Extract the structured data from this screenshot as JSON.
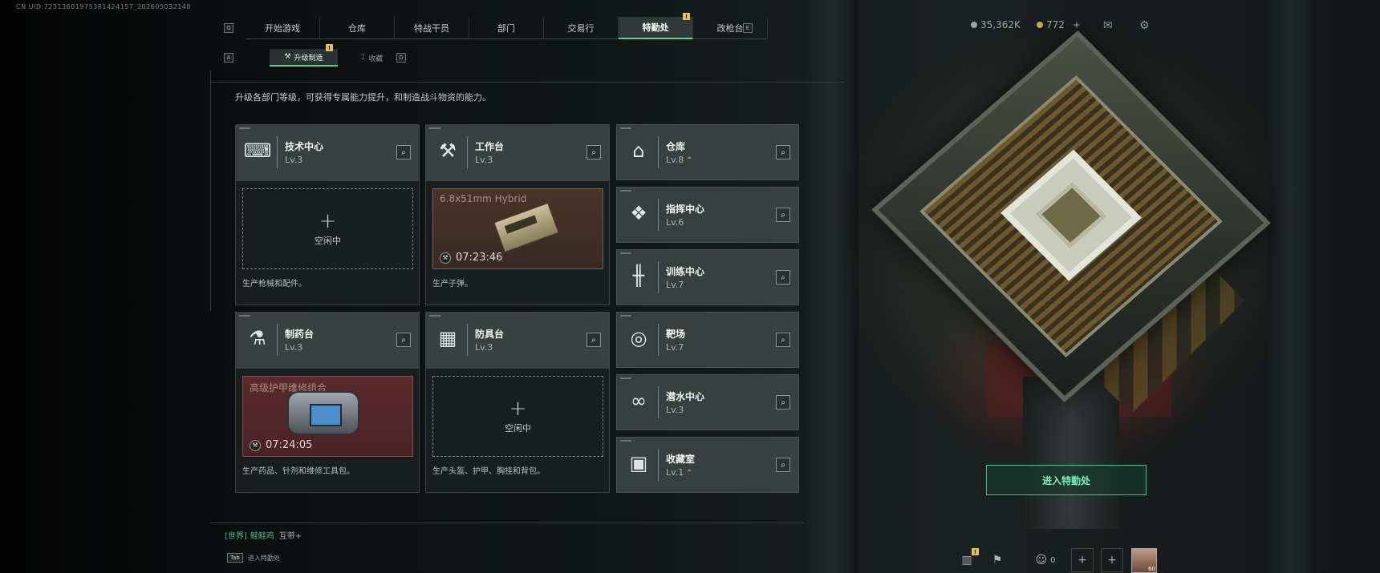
{
  "uid_text": "CN UID:7231360197538142415​7_202605032148",
  "top_tabs": {
    "left_key": "Q",
    "right_key": "E",
    "items": [
      {
        "label": "开始游戏"
      },
      {
        "label": "仓库"
      },
      {
        "label": "特战干员"
      },
      {
        "label": "部门"
      },
      {
        "label": "交易行"
      },
      {
        "label": "特勤处",
        "active": true,
        "badge": "!"
      },
      {
        "label": "改枪台"
      }
    ]
  },
  "sub_tabs": {
    "left_key": "A",
    "right_key": "D",
    "items": [
      {
        "label": "升级制造",
        "icon": "wrench-icon",
        "active": true,
        "badge": "!"
      },
      {
        "label": "收藏",
        "icon": "pin-icon"
      }
    ]
  },
  "resources": {
    "currency_a": "35,362K",
    "currency_b": "772",
    "plus": "+"
  },
  "description": "升级各部门等级，可获得专属能力提升，和制造战斗物资的能力。",
  "big_cards": [
    {
      "title": "技术中心",
      "level": "Lv.3",
      "icon": "tech-center-icon",
      "slot": {
        "type": "empty",
        "label": "空闲中",
        "plus": "+"
      },
      "footer": "生产枪械和配件。"
    },
    {
      "title": "工作台",
      "level": "Lv.3",
      "icon": "workbench-icon",
      "slot": {
        "type": "production",
        "name": "6.8x51mm Hybrid",
        "time": "07:23:46",
        "item": "ammo-box"
      },
      "footer": "生产子弹。"
    },
    {
      "title": "制药台",
      "level": "Lv.3",
      "icon": "pharmacy-icon",
      "slot": {
        "type": "production",
        "name": "高级护甲维修组合",
        "time": "07:24:05",
        "item": "repair-kit"
      },
      "footer": "生产药品、针剂和维修工具包。"
    },
    {
      "title": "防具台",
      "level": "Lv.3",
      "icon": "armor-bench-icon",
      "slot": {
        "type": "empty",
        "label": "空闲中",
        "plus": "+"
      },
      "footer": "生产头盔、护甲、胸挂和背包。"
    }
  ],
  "small_cards": [
    {
      "title": "仓库",
      "level": "Lv.8",
      "upgrade": "⌃",
      "icon": "warehouse-icon"
    },
    {
      "title": "指挥中心",
      "level": "Lv.6",
      "icon": "command-center-icon"
    },
    {
      "title": "训练中心",
      "level": "Lv.7",
      "icon": "dumbbell-icon"
    },
    {
      "title": "靶场",
      "level": "Lv.7",
      "icon": "target-icon"
    },
    {
      "title": "潜水中心",
      "level": "Lv.3",
      "icon": "diving-mask-icon"
    },
    {
      "title": "收藏室",
      "level": "Lv.1",
      "upgrade": "⌃",
      "icon": "collection-room-icon"
    }
  ],
  "enter_button": "进入特勤处",
  "chat": {
    "channel": "[世界]",
    "name": "鲑鲑鸡",
    "message": "互带+"
  },
  "tab_hint": {
    "key": "Tab",
    "label": "进入特勤处"
  },
  "bottom": {
    "friends_count": "0",
    "avatar_level": "60",
    "badge": "!"
  },
  "colors": {
    "accent": "#4fd39c",
    "badge": "#e0c45a",
    "upgrade": "#e1b84c"
  }
}
